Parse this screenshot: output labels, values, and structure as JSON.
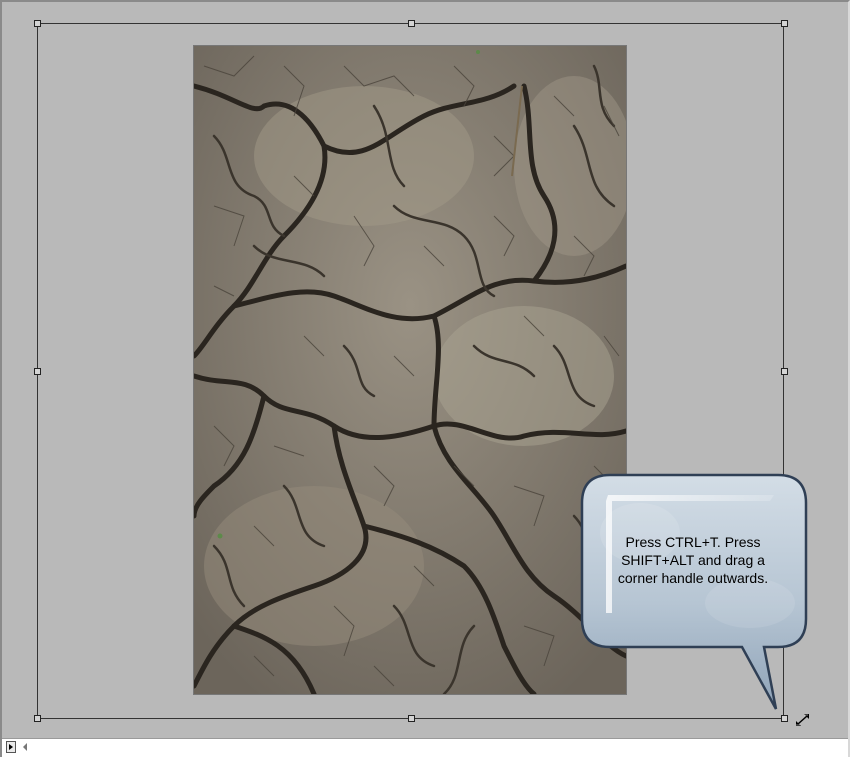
{
  "canvas": {
    "background_color": "#b9b9b9",
    "document": {
      "name": "cracked-earth-texture",
      "description_icon": "cracked-dry-soil"
    }
  },
  "transform": {
    "handles": [
      "top-left",
      "top-center",
      "top-right",
      "middle-left",
      "middle-right",
      "bottom-left",
      "bottom-center",
      "bottom-right"
    ],
    "cursor_icon": "resize-diagonal-arrow-icon"
  },
  "callout": {
    "text": "Press CTRL+T. Press\nSHIFT+ALT and drag a\ncorner handle outwards.",
    "fill_color": "#b7c7d6",
    "border_color": "#2f3f55"
  },
  "status_bar": {
    "menu_icon": "play-triangle-icon",
    "scroll_icon": "scroll-left-icon"
  }
}
